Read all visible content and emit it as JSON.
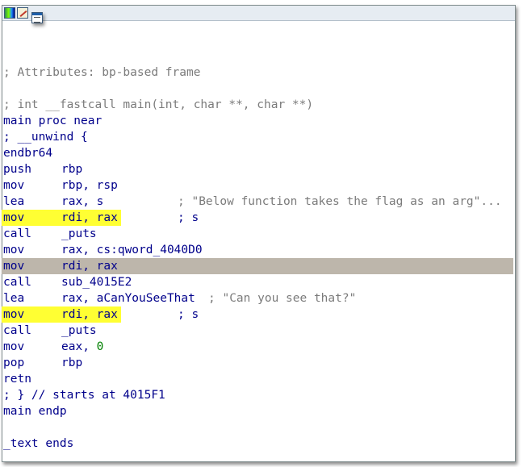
{
  "toolbar": {
    "icons": [
      "graph-view-icon",
      "edit-icon",
      "window-icon"
    ]
  },
  "lines": [
    {
      "kind": "blank"
    },
    {
      "kind": "comment",
      "text": "; Attributes: bp-based frame"
    },
    {
      "kind": "blank"
    },
    {
      "kind": "comment",
      "text": "; int __fastcall main(int, char **, char **)"
    },
    {
      "kind": "label",
      "text": "main proc near"
    },
    {
      "kind": "label",
      "text": "; __unwind {"
    },
    {
      "kind": "ins",
      "op": "endbr64",
      "arg": "",
      "cmt": ""
    },
    {
      "kind": "ins",
      "op": "push",
      "arg": "rbp",
      "cmt": ""
    },
    {
      "kind": "ins",
      "op": "mov",
      "arg": "rbp, rsp",
      "cmt": ""
    },
    {
      "kind": "ins",
      "op": "lea",
      "arg": "rax, s",
      "cmt": "; \"Below function takes the flag as an arg\"..."
    },
    {
      "kind": "ins",
      "op": "mov",
      "arg": "rdi, rax",
      "cmt": "; s",
      "highlight": "yellow"
    },
    {
      "kind": "ins",
      "op": "call",
      "arg": "_puts",
      "cmt": ""
    },
    {
      "kind": "ins",
      "op": "mov",
      "arg": "rax, cs:qword_4040D0",
      "cmt": ""
    },
    {
      "kind": "ins",
      "op": "mov",
      "arg": "rdi, rax",
      "cmt": "",
      "highlight": "gray"
    },
    {
      "kind": "ins",
      "op": "call",
      "arg": "sub_4015E2",
      "cmt": ""
    },
    {
      "kind": "ins",
      "op": "lea",
      "arg": "rax, aCanYouSeeThat",
      "cmt2": "; \"Can you see that?\""
    },
    {
      "kind": "ins",
      "op": "mov",
      "arg": "rdi, rax",
      "cmt": "; s",
      "highlight": "yellow"
    },
    {
      "kind": "ins",
      "op": "call",
      "arg": "_puts",
      "cmt": ""
    },
    {
      "kind": "ins",
      "op": "mov",
      "arg": "eax, ",
      "num": "0",
      "cmt": ""
    },
    {
      "kind": "ins",
      "op": "pop",
      "arg": "rbp",
      "cmt": ""
    },
    {
      "kind": "ins",
      "op": "retn",
      "arg": "",
      "cmt": ""
    },
    {
      "kind": "label",
      "text": "; } // starts at 4015F1"
    },
    {
      "kind": "label",
      "text": "main endp"
    },
    {
      "kind": "blank"
    },
    {
      "kind": "label",
      "text": "_text ends"
    }
  ],
  "colors": {
    "highlight_yellow": "#ffff33",
    "highlight_gray": "#bdb6ab",
    "instruction": "#00008b",
    "comment": "#7b7b7b",
    "number": "#008000"
  }
}
